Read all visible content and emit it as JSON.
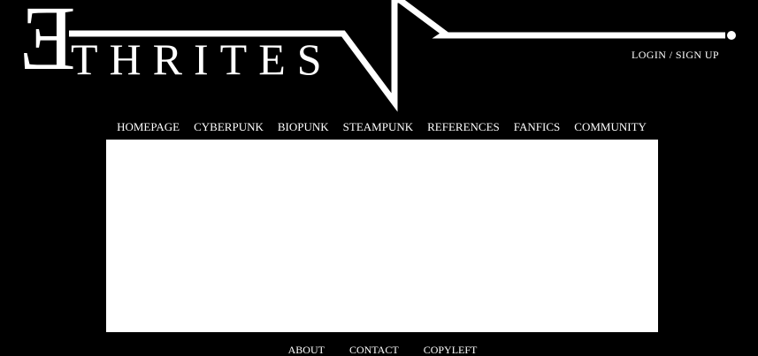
{
  "brand": {
    "first_letter": "E",
    "rest": "THRITES"
  },
  "header": {
    "login_label": "LOGIN / SIGN UP"
  },
  "nav": {
    "items": [
      {
        "label": "HOMEPAGE"
      },
      {
        "label": "CYBERPUNK"
      },
      {
        "label": "BIOPUNK"
      },
      {
        "label": "STEAMPUNK"
      },
      {
        "label": "REFERENCES"
      },
      {
        "label": "FANFICS"
      },
      {
        "label": "COMMUNITY"
      }
    ]
  },
  "footer": {
    "links": [
      {
        "label": "ABOUT"
      },
      {
        "label": "CONTACT"
      },
      {
        "label": "COPYLEFT"
      }
    ]
  },
  "colors": {
    "background": "#000000",
    "text": "#ffffff",
    "panel": "#ffffff"
  }
}
